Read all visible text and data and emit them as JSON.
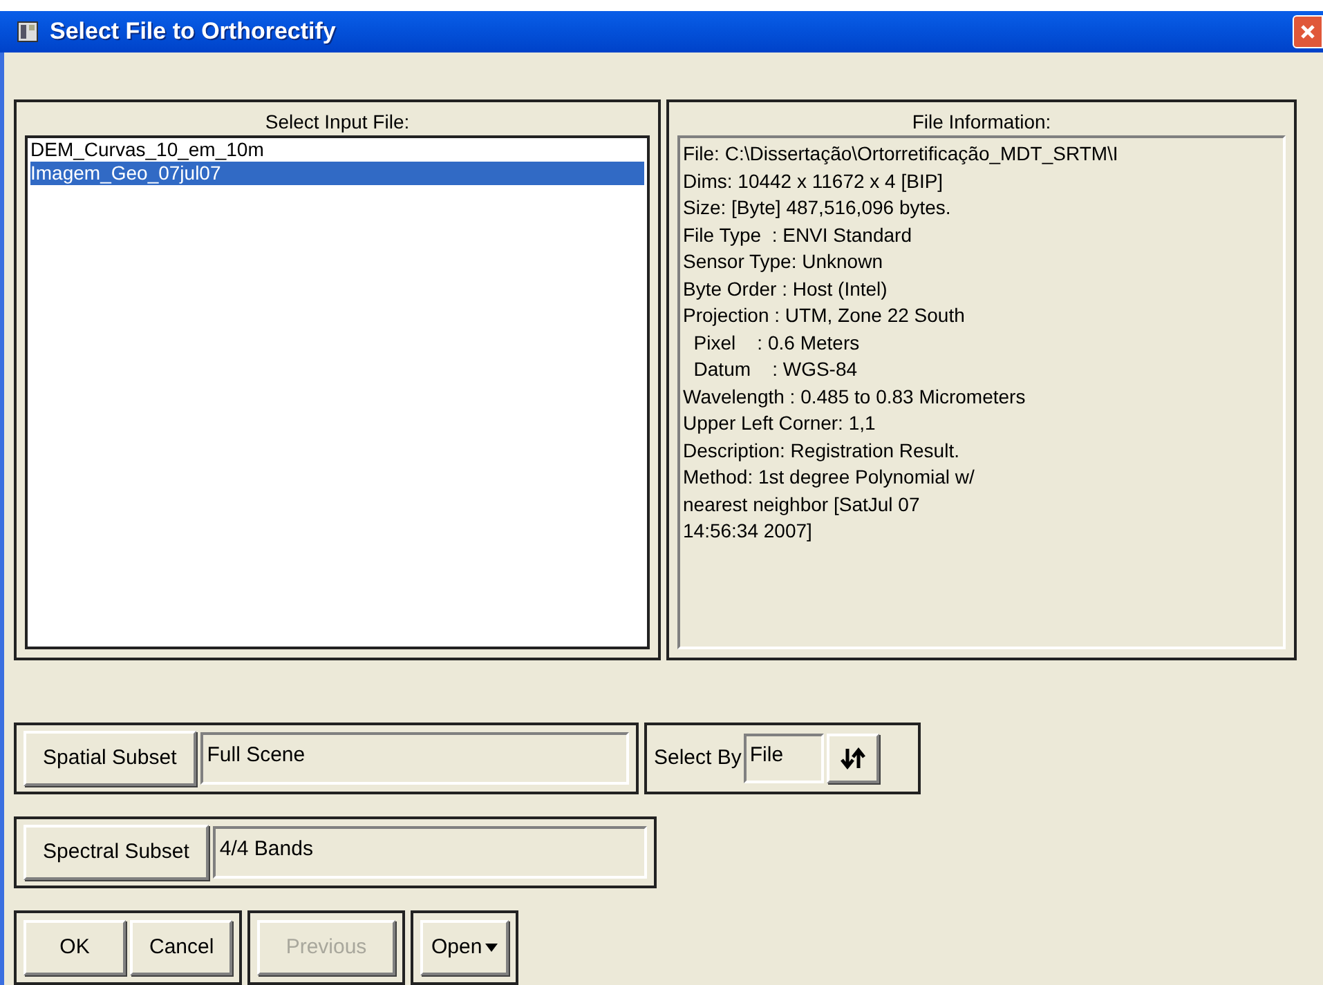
{
  "window": {
    "title": "Select File to Orthorectify"
  },
  "input_files": {
    "title": "Select Input File:",
    "items": [
      {
        "label": "DEM_Curvas_10_em_10m",
        "selected": false
      },
      {
        "label": "Imagem_Geo_07jul07",
        "selected": true
      }
    ]
  },
  "file_information": {
    "title": "File Information:",
    "lines": [
      "File: C:\\Dissertação\\Ortorretificação_MDT_SRTM\\I",
      "Dims: 10442 x 11672 x 4 [BIP]",
      "Size: [Byte] 487,516,096 bytes.",
      "File Type  : ENVI Standard",
      "Sensor Type: Unknown",
      "Byte Order : Host (Intel)",
      "Projection : UTM, Zone 22 South",
      "  Pixel    : 0.6 Meters",
      "  Datum    : WGS-84",
      "Wavelength : 0.485 to 0.83 Micrometers",
      "Upper Left Corner: 1,1",
      "Description: Registration Result.",
      "Method: 1st degree Polynomial w/",
      "nearest neighbor [SatJul 07",
      "14:56:34 2007]"
    ]
  },
  "spatial_subset": {
    "button": "Spatial Subset",
    "value": "Full Scene"
  },
  "select_by": {
    "label": "Select By",
    "value": "File"
  },
  "spectral_subset": {
    "button": "Spectral Subset",
    "value": "4/4 Bands"
  },
  "buttons": [
    {
      "label": "OK",
      "disabled": false
    },
    {
      "label": "Cancel",
      "disabled": false
    }
  ],
  "previous_button": {
    "label": "Previous",
    "disabled": true
  },
  "open_button": {
    "label": "Open"
  }
}
